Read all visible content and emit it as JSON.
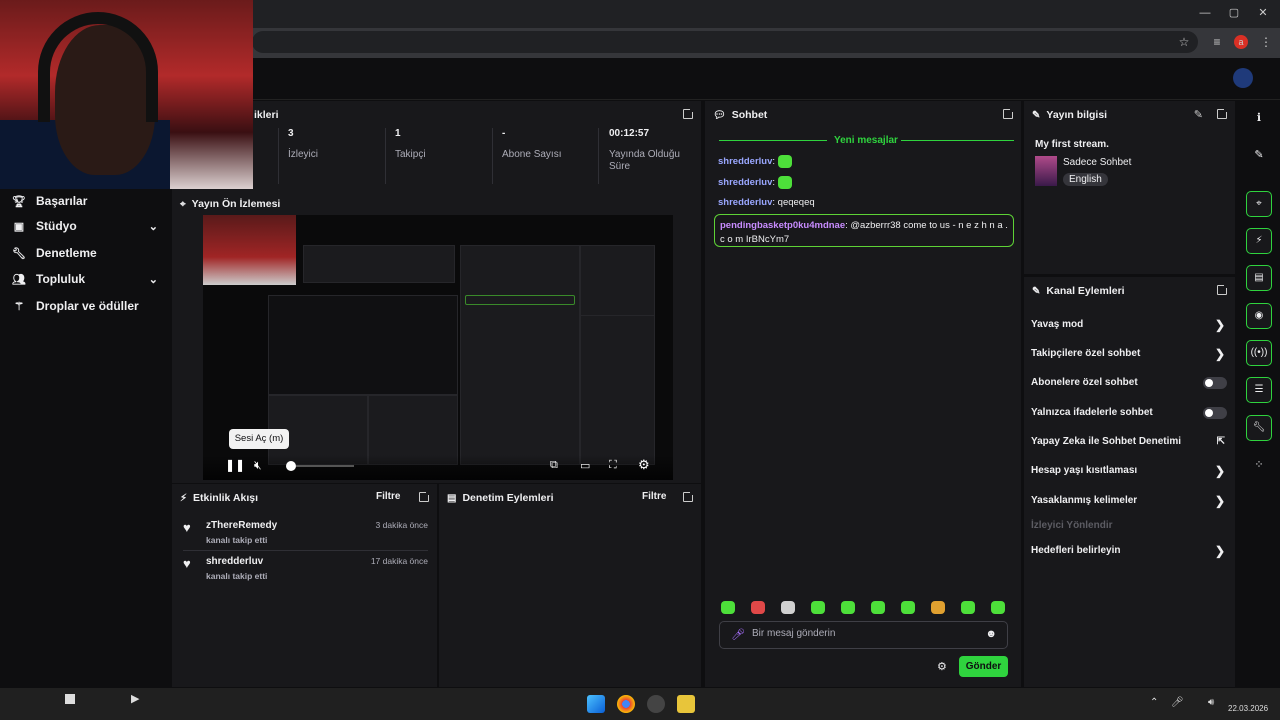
{
  "browser": {
    "window_controls": [
      "—",
      "▢",
      "✕"
    ],
    "profile_initial": "a"
  },
  "sidebar": {
    "items": [
      {
        "label": "Başarılar",
        "icon": "trophy-icon",
        "has_chevron": false
      },
      {
        "label": "Stüdyo",
        "icon": "studio-icon",
        "has_chevron": true
      },
      {
        "label": "Denetleme",
        "icon": "wrench-icon",
        "has_chevron": false
      },
      {
        "label": "Topluluk",
        "icon": "community-icon",
        "has_chevron": true
      },
      {
        "label": "Droplar ve ödüller",
        "icon": "drops-icon",
        "has_chevron": false
      }
    ]
  },
  "stats": {
    "title_fragment": "ikleri",
    "items": [
      {
        "value": "3",
        "label": "İzleyici"
      },
      {
        "value": "1",
        "label": "Takipçi"
      },
      {
        "value": "-",
        "label": "Abone Sayısı"
      },
      {
        "value": "00:12:57",
        "label": "Yayında Olduğu Süre"
      }
    ]
  },
  "preview": {
    "title": "Yayın Ön İzlemesi",
    "tooltip": "Sesi Aç (m)"
  },
  "activity": {
    "title": "Etkinlik Akışı",
    "filter_label": "Filtre",
    "items": [
      {
        "name": "zThereRemedy",
        "action": "kanalı takip etti",
        "time": "3 dakika önce"
      },
      {
        "name": "shredderluv",
        "action": "kanalı takip etti",
        "time": "17 dakika önce"
      }
    ]
  },
  "moderation": {
    "title": "Denetim Eylemleri",
    "filter_label": "Filtre"
  },
  "chat": {
    "title": "Sohbet",
    "new_messages": "Yeni mesajlar",
    "messages": [
      {
        "user": "shredderluv",
        "text": ""
      },
      {
        "user": "shredderluv",
        "text": ""
      },
      {
        "user": "shredderluv",
        "text": "qeqeqeq"
      }
    ],
    "highlight": {
      "user": "pendingbasketp0ku4mdnae",
      "text": "@azberrr38 come to us - n e z h n a . c o m IrBNcYm7"
    },
    "input_placeholder": "Bir mesaj gönderin",
    "send_label": "Gönder",
    "emote_colors": [
      "#4ddf3a",
      "#e04848",
      "#d0d0d0",
      "#4ddf3a",
      "#4ddf3a",
      "#4ddf3a",
      "#4ddf3a",
      "#e0a030",
      "#4ddf3a",
      "#4ddf3a"
    ]
  },
  "stream_info": {
    "title": "Yayın bilgisi",
    "stream_title": "My first stream.",
    "category": "Sadece Sohbet",
    "tag": "English"
  },
  "channel_actions": {
    "title": "Kanal Eylemleri",
    "items": [
      {
        "label": "Yavaş mod",
        "control": "chevron"
      },
      {
        "label": "Takipçilere özel sohbet",
        "control": "chevron"
      },
      {
        "label": "Abonelere özel sohbet",
        "control": "toggle"
      },
      {
        "label": "Yalnızca ifadelerle sohbet",
        "control": "toggle"
      },
      {
        "label": "Yapay Zeka ile Sohbet Denetimi",
        "control": "external"
      },
      {
        "label": "Hesap yaşı kısıtlaması",
        "control": "chevron"
      },
      {
        "label": "Yasaklanmış kelimeler",
        "control": "chevron"
      },
      {
        "label": "İzleyici Yönlendir",
        "control": "disabled"
      },
      {
        "label": "Hedefleri belirleyin",
        "control": "chevron"
      }
    ]
  },
  "taskbar": {
    "date": "22.03.2026"
  },
  "colors": {
    "accent": "#2fd33e",
    "panel": "#18181b",
    "bg": "#0e0e10"
  }
}
